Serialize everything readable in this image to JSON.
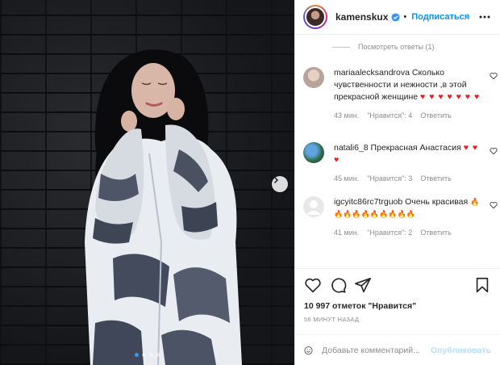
{
  "header": {
    "username": "kamenskux",
    "separator": "•",
    "follow_label": "Подписаться"
  },
  "comments": {
    "view_replies": "Посмотреть ответы (1)",
    "items": [
      {
        "user": "mariaalecksandrova",
        "text": "Сколько чувственности и нежности ,в этой прекрасной женщине",
        "hearts": "♥ ♥ ♥ ♥ ♥ ♥ ♥",
        "time": "43 мин.",
        "likes": "\"Нравится\": 4",
        "reply": "Ответить"
      },
      {
        "user": "natali6_8",
        "text": "Прекрасная Анастасия",
        "hearts": "♥ ♥ ♥",
        "time": "45 мин.",
        "likes": "\"Нравится\": 3",
        "reply": "Ответить"
      },
      {
        "user": "igcyitc86rc7trguob",
        "text": "Очень красивая",
        "hearts": "🔥🔥🔥🔥🔥🔥🔥🔥🔥🔥",
        "time": "41 мин.",
        "likes": "\"Нравится\": 2",
        "reply": "Ответить"
      }
    ]
  },
  "footer": {
    "likes_count": "10 997 отметок \"Нравится\"",
    "time_ago": "56 МИНУТ НАЗАД",
    "comment_placeholder": "Добавьте комментарий...",
    "publish_label": "Опубликовать"
  },
  "icons": {
    "verified": "verified-badge-icon",
    "more": "more-options-icon",
    "like": "heart-icon",
    "comment": "comment-icon",
    "share": "share-icon",
    "save": "bookmark-icon",
    "emoji": "emoji-icon",
    "next": "chevron-right-icon"
  },
  "colors": {
    "accent": "#0095f6",
    "heart": "#ed1c24",
    "muted": "#8e8e8e",
    "publish_disabled": "#b2dffc"
  },
  "carousel": {
    "count": 4,
    "active": 0
  }
}
